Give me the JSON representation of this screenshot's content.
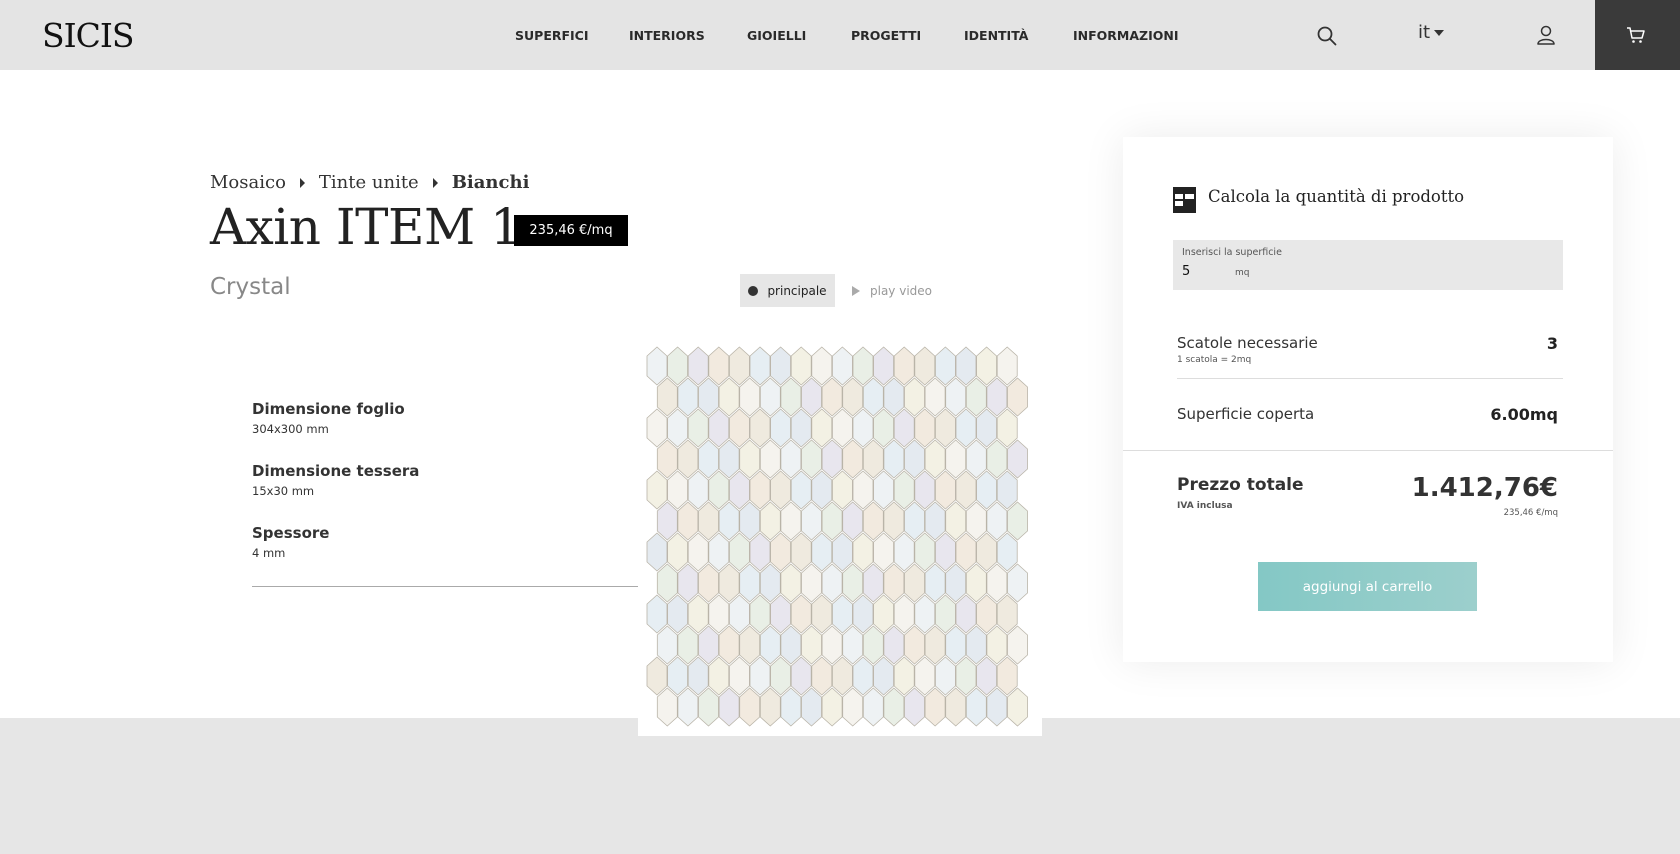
{
  "header": {
    "logo": "SICIS",
    "nav": [
      {
        "label": "SUPERFICI"
      },
      {
        "label": "INTERIORS"
      },
      {
        "label": "GIOIELLI"
      },
      {
        "label": "PROGETTI"
      },
      {
        "label": "IDENTITÀ"
      },
      {
        "label": "INFORMAZIONI"
      }
    ],
    "language": "it",
    "icons": {
      "search": "search-icon",
      "user": "user-icon",
      "cart": "cart-icon"
    }
  },
  "product": {
    "breadcrumb": [
      "Mosaico",
      "Tinte unite",
      "Bianchi"
    ],
    "title": "Axin ITEM 1",
    "price": "235,46 €/mq",
    "subtitle": "Crystal",
    "view_buttons": {
      "main": "principale",
      "video": "play video"
    },
    "specs": [
      {
        "label": "Dimensione foglio",
        "value": "304x300 mm"
      },
      {
        "label": "Dimensione tessera",
        "value": "15x30 mm"
      },
      {
        "label": "Spessore",
        "value": "4 mm"
      }
    ]
  },
  "calculator": {
    "title": "Calcola la quantità di prodotto",
    "input": {
      "label": "Inserisci la superficie",
      "value": "5",
      "unit": "mq"
    },
    "boxes": {
      "label": "Scatole necessarie",
      "sub": "1 scatola = 2mq",
      "value": "3"
    },
    "coverage": {
      "label": "Superficie coperta",
      "value": "6.00mq"
    },
    "total": {
      "label": "Prezzo totale",
      "sub": "IVA inclusa",
      "value": "1.412,76€",
      "unit_price": "235,46 €/mq"
    },
    "cta": "aggiungi al carrello"
  },
  "colors": {
    "accent": "#8ccbc8",
    "header_bg": "#e4e4e4",
    "cart_bg": "#3a3a3a"
  }
}
